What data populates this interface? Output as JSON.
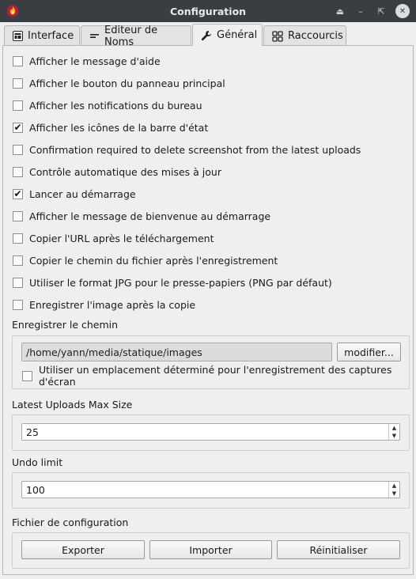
{
  "window": {
    "title": "Configuration",
    "controls": [
      "⏏",
      "–",
      "⇱",
      "✕"
    ]
  },
  "tabs": [
    {
      "label": "Interface",
      "icon": "interface-icon"
    },
    {
      "label": "Editeur de Noms",
      "icon": "dash-icon"
    },
    {
      "label": "Général",
      "icon": "wrench-icon",
      "active": true
    },
    {
      "label": "Raccourcis",
      "icon": "grid-icon"
    }
  ],
  "options": [
    {
      "label": "Afficher le message d'aide",
      "checked": false
    },
    {
      "label": "Afficher le bouton du panneau principal",
      "checked": false
    },
    {
      "label": "Afficher les notifications du bureau",
      "checked": false
    },
    {
      "label": "Afficher les icônes de la barre d'état",
      "checked": true
    },
    {
      "label": "Confirmation required to delete screenshot from the latest uploads",
      "checked": false
    },
    {
      "label": "Contrôle automatique des mises à jour",
      "checked": false
    },
    {
      "label": "Lancer au démarrage",
      "checked": true
    },
    {
      "label": "Afficher le message de bienvenue au démarrage",
      "checked": false
    },
    {
      "label": "Copier l'URL après le téléchargement",
      "checked": false
    },
    {
      "label": "Copier le chemin du fichier après l'enregistrement",
      "checked": false
    },
    {
      "label": "Utiliser le format JPG pour le presse-papiers (PNG par défaut)",
      "checked": false
    },
    {
      "label": "Enregistrer l'image après la copie",
      "checked": false
    }
  ],
  "save_path": {
    "title": "Enregistrer le chemin",
    "value": "/home/yann/media/statique/images",
    "modify_label": "modifier...",
    "fixed_location_label": "Utiliser un emplacement déterminé pour l'enregistrement des captures d'écran",
    "fixed_location_checked": false
  },
  "latest_uploads": {
    "title": "Latest Uploads Max Size",
    "value": "25"
  },
  "undo": {
    "title": "Undo limit",
    "value": "100"
  },
  "config_file": {
    "title": "Fichier de configuration",
    "export_label": "Exporter",
    "import_label": "Importer",
    "reset_label": "Réinitialiser"
  },
  "colors": {
    "titlebar": "#3a3d41",
    "background": "#efefef",
    "app_icon": "#d9344a"
  }
}
